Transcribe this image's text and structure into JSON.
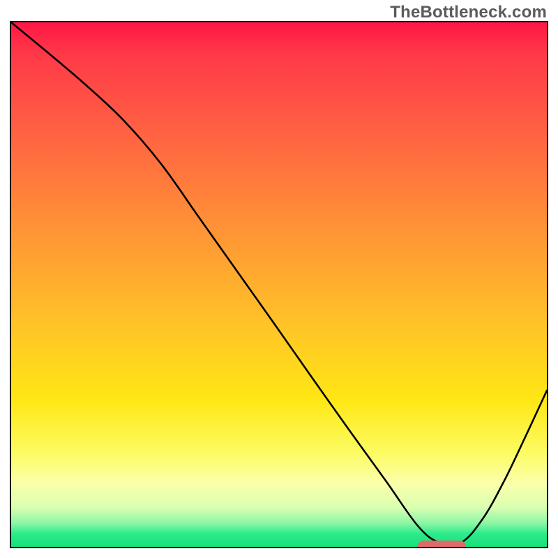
{
  "watermark": "TheBottleneck.com",
  "colors": {
    "gradient_top": "#ff1745",
    "gradient_bottom": "#17e07b",
    "curve_stroke": "#000000",
    "marker_fill": "#e06a6b",
    "frame_border": "#000000"
  },
  "chart_data": {
    "type": "line",
    "title": "",
    "xlabel": "",
    "ylabel": "",
    "xlim": [
      0,
      100
    ],
    "ylim": [
      0,
      100
    ],
    "grid": false,
    "legend": false,
    "x": [
      0,
      7,
      14,
      21,
      28,
      35,
      42,
      49,
      56,
      63,
      70,
      76,
      80,
      84,
      88,
      92,
      96,
      100
    ],
    "series": [
      {
        "name": "bottleneck-curve",
        "values": [
          100,
          94.1,
          88.0,
          81.3,
          73.0,
          62.9,
          52.8,
          42.7,
          32.5,
          22.4,
          12.5,
          3.9,
          0.8,
          0.8,
          5.3,
          12.5,
          21.0,
          29.8
        ]
      }
    ],
    "annotations": [
      {
        "name": "optimal-range-marker",
        "type": "bar",
        "x_start": 75.5,
        "x_end": 84.5,
        "y": 0.6,
        "color": "#e06a6b"
      }
    ]
  }
}
